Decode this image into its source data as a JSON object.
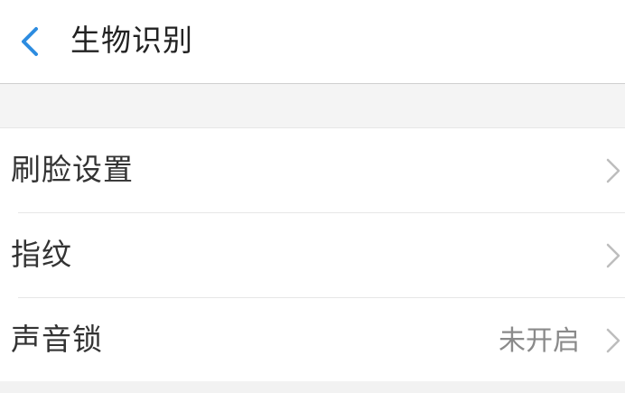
{
  "header": {
    "back_icon": "chevron-left-icon",
    "title": "生物识别"
  },
  "items": [
    {
      "label": "刷脸设置",
      "value": "",
      "icon": "chevron-right-icon"
    },
    {
      "label": "指纹",
      "value": "",
      "icon": "chevron-right-icon"
    },
    {
      "label": "声音锁",
      "value": "未开启",
      "icon": "chevron-right-icon"
    }
  ],
  "colors": {
    "accent": "#2d8ce0",
    "background": "#f4f4f4",
    "text": "#333333",
    "secondary_text": "#8a8a8a",
    "chevron": "#bdbdbd"
  }
}
